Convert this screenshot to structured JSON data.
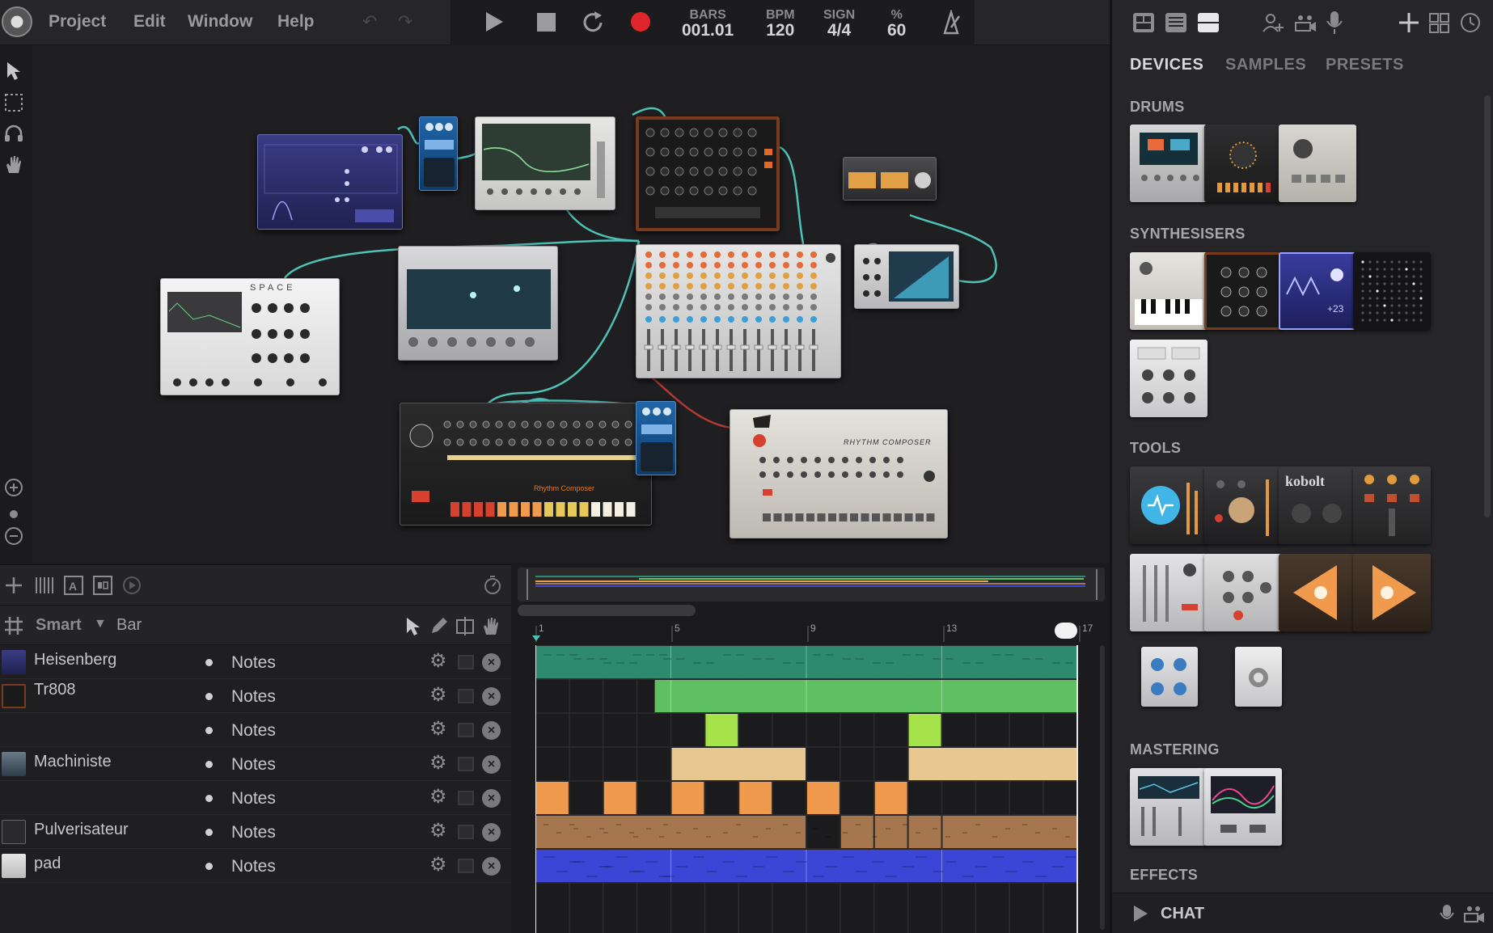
{
  "menu": {
    "project": "Project",
    "edit": "Edit",
    "window": "Window",
    "help": "Help"
  },
  "transport": {
    "bars_label": "BARS",
    "bars_value": "001.01",
    "bpm_label": "BPM",
    "bpm_value": "120",
    "sign_label": "SIGN",
    "sign_value": "4/4",
    "swing_label": "%",
    "swing_value": "60"
  },
  "sequencer": {
    "grid_mode": "Smart",
    "grid_unit": "Bar",
    "ruler": [
      "1",
      "5",
      "9",
      "13",
      "17"
    ],
    "tracks": [
      {
        "name": "Heisenberg",
        "lane": "Notes"
      },
      {
        "name": "Tr808",
        "lane": "Notes"
      },
      {
        "name": "",
        "lane": "Notes"
      },
      {
        "name": "Machiniste",
        "lane": "Notes"
      },
      {
        "name": "",
        "lane": "Notes"
      },
      {
        "name": "Pulverisateur",
        "lane": "Notes"
      },
      {
        "name": "pad",
        "lane": "Notes"
      }
    ]
  },
  "devices": {
    "space_label": "SPACE",
    "rhythm_composer_label": "RHYTHM COMPOSER",
    "rhythm_composer_label2": "Rhythm Composer"
  },
  "browser": {
    "tabs": {
      "devices": "DEVICES",
      "samples": "SAMPLES",
      "presets": "PRESETS"
    },
    "sections": {
      "drums": "DRUMS",
      "synthesisers": "SYNTHESISERS",
      "tools": "TOOLS",
      "mastering": "MASTERING",
      "effects": "EFFECTS"
    },
    "kobolt_label": "kobolt"
  },
  "chat": {
    "label": "CHAT"
  },
  "colors": {
    "accent_active_tab": "#d8d8da",
    "clip_heisenberg": "#2e8a6e",
    "clip_tr808": "#5ec063",
    "clip_tr808_b": "#a6e24a",
    "clip_machiniste": "#e8c690",
    "clip_machiniste_b": "#ef9a4c",
    "clip_pulverisateur": "#a6764e",
    "clip_pad": "#3b46d6",
    "cable": "#4fc2b8",
    "record": "#e0252b"
  }
}
